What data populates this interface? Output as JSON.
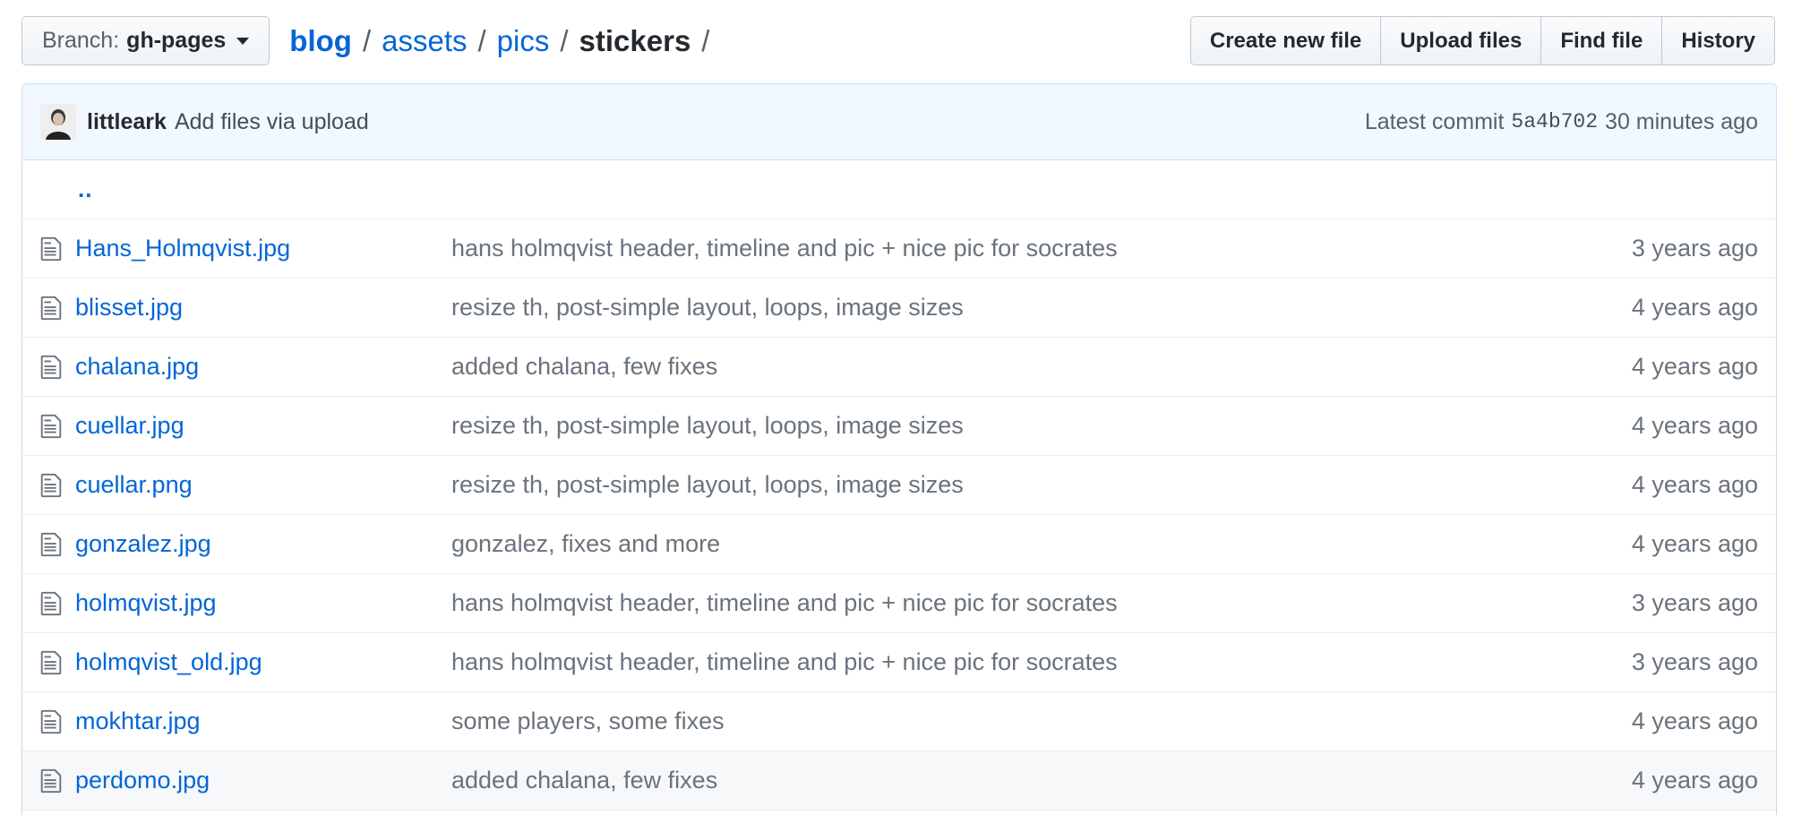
{
  "branch": {
    "label": "Branch:",
    "value": "gh-pages"
  },
  "breadcrumb": {
    "parts": [
      "blog",
      "assets",
      "pics"
    ],
    "current": "stickers",
    "separator": "/"
  },
  "actions": {
    "create": "Create new file",
    "upload": "Upload files",
    "find": "Find file",
    "history": "History"
  },
  "commit": {
    "author": "littleark",
    "message": "Add files via upload",
    "latest_label": "Latest commit",
    "sha": "5a4b702",
    "time": "30 minutes ago"
  },
  "parent_dir": "..",
  "files": [
    {
      "name": "Hans_Holmqvist.jpg",
      "message": "hans holmqvist header, timeline and pic + nice pic for socrates",
      "age": "3 years ago"
    },
    {
      "name": "blisset.jpg",
      "message": "resize th, post-simple layout, loops, image sizes",
      "age": "4 years ago"
    },
    {
      "name": "chalana.jpg",
      "message": "added chalana, few fixes",
      "age": "4 years ago"
    },
    {
      "name": "cuellar.jpg",
      "message": "resize th, post-simple layout, loops, image sizes",
      "age": "4 years ago"
    },
    {
      "name": "cuellar.png",
      "message": "resize th, post-simple layout, loops, image sizes",
      "age": "4 years ago"
    },
    {
      "name": "gonzalez.jpg",
      "message": "gonzalez, fixes and more",
      "age": "4 years ago"
    },
    {
      "name": "holmqvist.jpg",
      "message": "hans holmqvist header, timeline and pic + nice pic for socrates",
      "age": "3 years ago"
    },
    {
      "name": "holmqvist_old.jpg",
      "message": "hans holmqvist header, timeline and pic + nice pic for socrates",
      "age": "3 years ago"
    },
    {
      "name": "mokhtar.jpg",
      "message": "some players, some fixes",
      "age": "4 years ago"
    },
    {
      "name": "perdomo.jpg",
      "message": "added chalana, few fixes",
      "age": "4 years ago"
    }
  ],
  "colors": {
    "link": "#0366d6",
    "muted": "#6a737d",
    "commit_bg": "#f1f8ff",
    "hover_row": "#f6f8fa"
  },
  "icons": {
    "file": "file-text-icon",
    "caret": "caret-down-icon"
  }
}
